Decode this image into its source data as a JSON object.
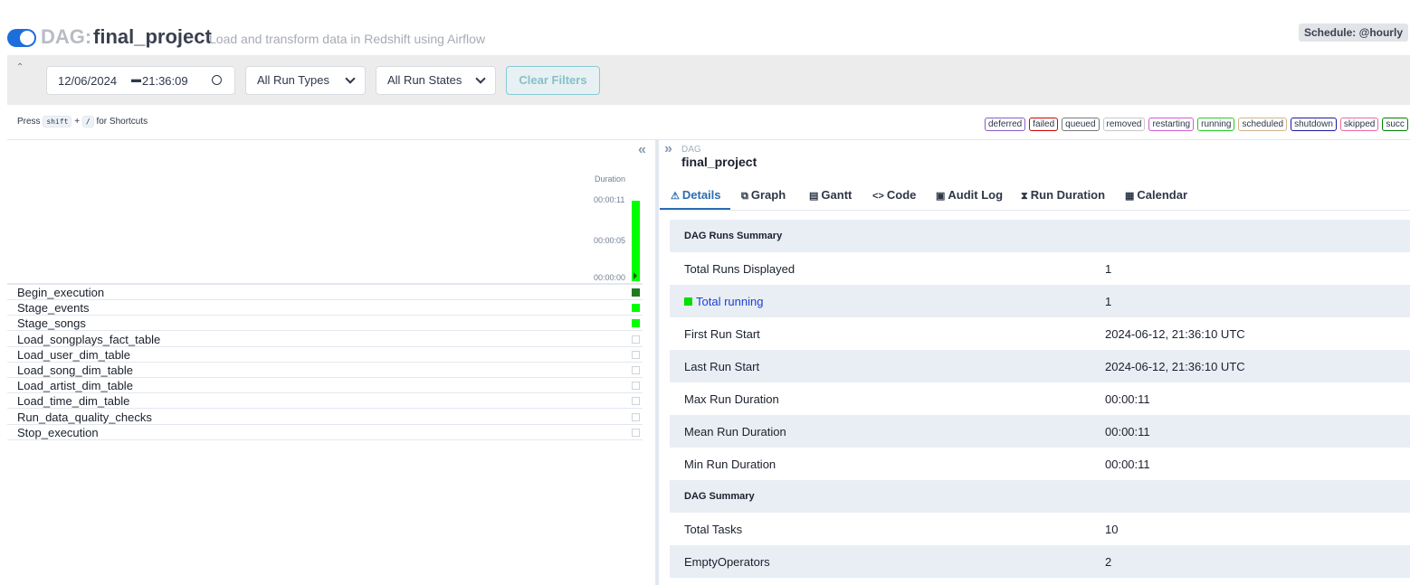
{
  "header": {
    "dag_prefix": "DAG:",
    "dag_name": "final_project",
    "description": "Load and transform data in Redshift using Airflow",
    "schedule": "Schedule: @hourly",
    "toggle_on": true
  },
  "filters": {
    "date": "12/06/2024",
    "time": "21:36:09",
    "run_types": "All Run Types",
    "run_states": "All Run States",
    "clear_label": "Clear Filters"
  },
  "shortcut": {
    "press": "Press",
    "key1": "shift",
    "plus": "+",
    "key2": "/",
    "suffix": "for Shortcuts"
  },
  "legend": [
    {
      "label": "deferred",
      "color": "#8a5cc8"
    },
    {
      "label": "failed",
      "color": "#d00000"
    },
    {
      "label": "queued",
      "color": "#7a7a7a"
    },
    {
      "label": "removed",
      "color": "#c8c8c8"
    },
    {
      "label": "restarting",
      "color": "#d25cd2"
    },
    {
      "label": "running",
      "color": "#22cc22"
    },
    {
      "label": "scheduled",
      "color": "#d2b48c"
    },
    {
      "label": "shutdown",
      "color": "#1a1aa0"
    },
    {
      "label": "skipped",
      "color": "#ee66aa"
    },
    {
      "label": "succ",
      "color": "#008000"
    }
  ],
  "grid": {
    "duration_title": "Duration",
    "ticks": [
      "00:00:11",
      "00:00:05",
      "00:00:00"
    ],
    "run_duration_fraction": 1.0,
    "tasks": [
      {
        "name": "Begin_execution",
        "state": "success",
        "color": "#1f7a1f"
      },
      {
        "name": "Stage_events",
        "state": "running",
        "color": "#00ff00"
      },
      {
        "name": "Stage_songs",
        "state": "running",
        "color": "#00ff00"
      },
      {
        "name": "Load_songplays_fact_table",
        "state": "none",
        "color": "#ffffff"
      },
      {
        "name": "Load_user_dim_table",
        "state": "none",
        "color": "#ffffff"
      },
      {
        "name": "Load_song_dim_table",
        "state": "none",
        "color": "#ffffff"
      },
      {
        "name": "Load_artist_dim_table",
        "state": "none",
        "color": "#ffffff"
      },
      {
        "name": "Load_time_dim_table",
        "state": "none",
        "color": "#ffffff"
      },
      {
        "name": "Run_data_quality_checks",
        "state": "none",
        "color": "#ffffff"
      },
      {
        "name": "Stop_execution",
        "state": "none",
        "color": "#ffffff"
      }
    ]
  },
  "details": {
    "crumb_label": "DAG",
    "crumb_name": "final_project",
    "tabs": [
      {
        "label": "Details",
        "icon": "warning-icon",
        "glyph": "⚠"
      },
      {
        "label": "Graph",
        "icon": "graph-icon",
        "glyph": "⧉"
      },
      {
        "label": "Gantt",
        "icon": "gantt-icon",
        "glyph": "▤"
      },
      {
        "label": "Code",
        "icon": "code-icon",
        "glyph": "<>"
      },
      {
        "label": "Audit Log",
        "icon": "audit-log-icon",
        "glyph": "▣"
      },
      {
        "label": "Run Duration",
        "icon": "hourglass-icon",
        "glyph": "⧗"
      },
      {
        "label": "Calendar",
        "icon": "calendar-icon",
        "glyph": "▦"
      }
    ],
    "rows": [
      {
        "key": "DAG Runs Summary",
        "value": "",
        "section": true
      },
      {
        "key": "Total Runs Displayed",
        "value": "1"
      },
      {
        "key": "Total running",
        "value": "1",
        "link": true
      },
      {
        "key": "First Run Start",
        "value": "2024-06-12, 21:36:10 UTC"
      },
      {
        "key": "Last Run Start",
        "value": "2024-06-12, 21:36:10 UTC"
      },
      {
        "key": "Max Run Duration",
        "value": "00:00:11"
      },
      {
        "key": "Mean Run Duration",
        "value": "00:00:11"
      },
      {
        "key": "Min Run Duration",
        "value": "00:00:11"
      },
      {
        "key": "DAG Summary",
        "value": "",
        "section": true
      },
      {
        "key": "Total Tasks",
        "value": "10"
      },
      {
        "key": "EmptyOperators",
        "value": "2"
      }
    ]
  }
}
